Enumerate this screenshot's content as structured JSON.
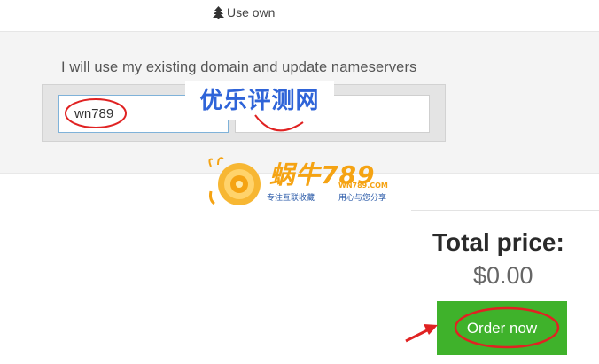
{
  "top_tab": {
    "label": "Use own"
  },
  "panel": {
    "label": "I will use my existing domain and update nameservers",
    "domain_value": "wn789",
    "tld_value": ""
  },
  "watermark": {
    "text": "优乐评测网",
    "logo_title": "蜗牛789",
    "logo_url": "WN789.COM",
    "slogan_a": "专注互联收藏",
    "slogan_b": "用心与您分享"
  },
  "summary": {
    "total_label": "Total price:",
    "total_value": "$0.00",
    "order_label": "Order now"
  },
  "colors": {
    "order_button": "#3fb22b",
    "input_focus_border": "#7fb2d9",
    "annotation_red": "#e02222",
    "watermark_blue": "#2f64d8",
    "logo_orange": "#f5a313"
  }
}
